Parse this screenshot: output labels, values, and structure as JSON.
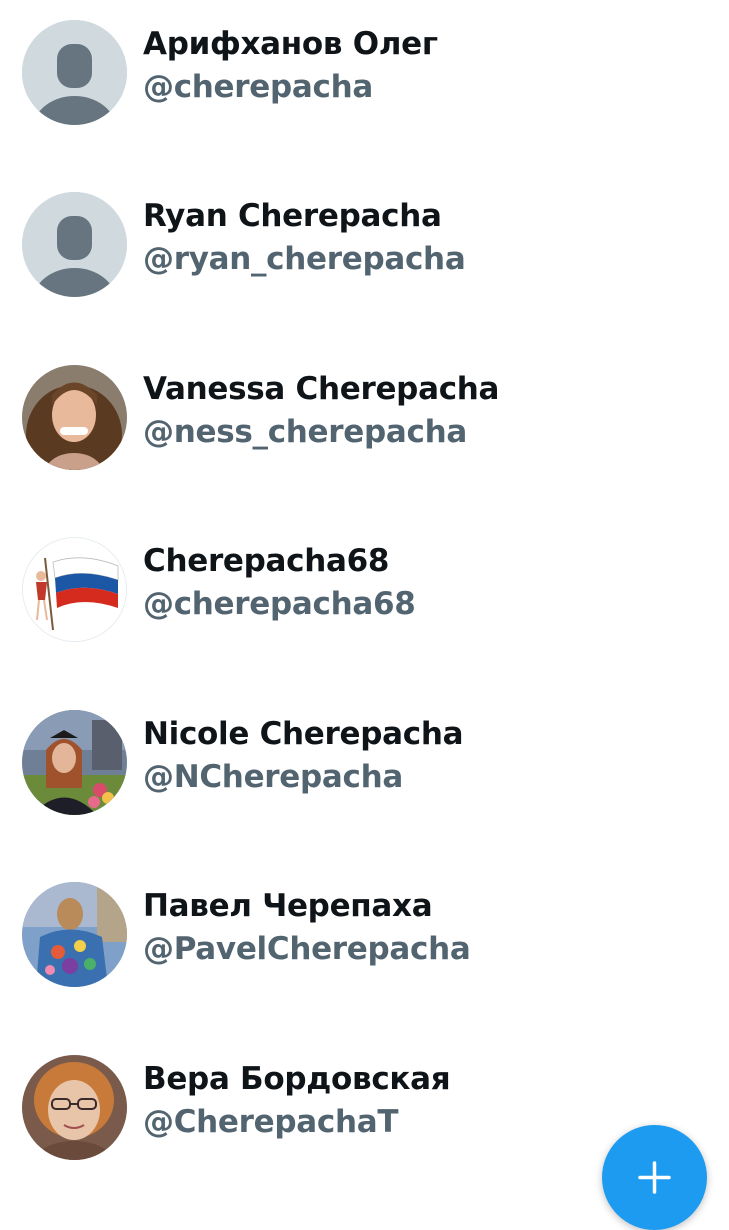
{
  "users": [
    {
      "name": "Арифханов Олег",
      "handle": "@cherepacha",
      "avatar": "default-avatar-icon"
    },
    {
      "name": "Ryan Cherepacha",
      "handle": "@ryan_cherepacha",
      "avatar": "default-avatar-icon"
    },
    {
      "name": "Vanessa Cherepacha",
      "handle": "@ness_cherepacha",
      "avatar": "photo-avatar"
    },
    {
      "name": "Cherepacha68",
      "handle": "@cherepacha68",
      "avatar": "russian-flag-avatar"
    },
    {
      "name": "Nicole Cherepacha",
      "handle": "@NCherepacha",
      "avatar": "photo-avatar"
    },
    {
      "name": "Павел Черепаха",
      "handle": "@PavelCherepacha",
      "avatar": "photo-avatar"
    },
    {
      "name": "Вера Бордовская",
      "handle": "@CherepachaT",
      "avatar": "photo-avatar"
    }
  ],
  "fab": {
    "icon": "plus-icon"
  },
  "colors": {
    "name_text": "#0f1419",
    "handle_text": "#536471",
    "default_avatar_bg": "#cfd9de",
    "default_avatar_fg": "#66757f",
    "fab_bg": "#1d9bf0"
  }
}
